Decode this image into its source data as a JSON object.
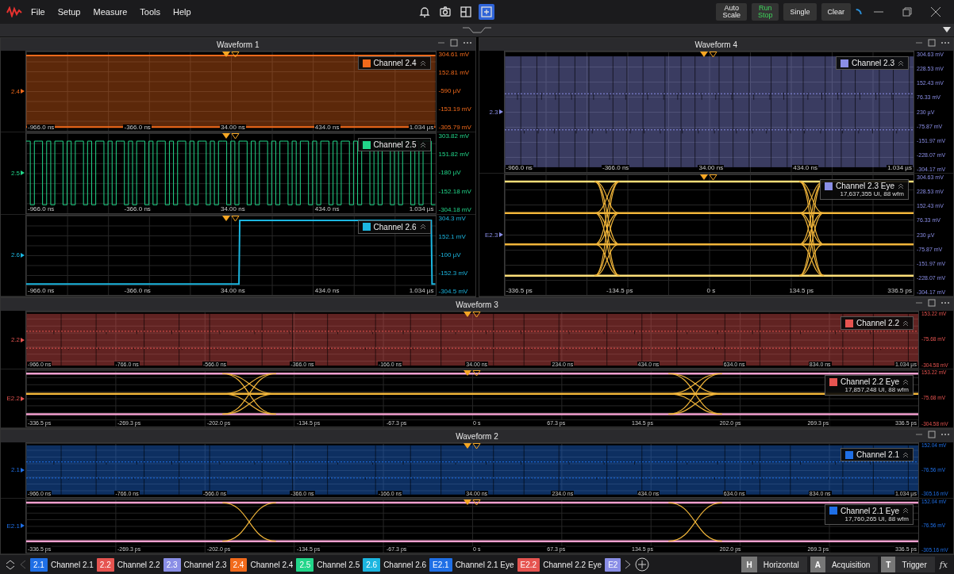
{
  "menubar": {
    "menus": [
      "File",
      "Setup",
      "Measure",
      "Tools",
      "Help"
    ],
    "tools": [
      {
        "kind": "bell",
        "selected": false
      },
      {
        "kind": "camera",
        "selected": false
      },
      {
        "kind": "layout",
        "selected": false
      },
      {
        "kind": "add-pane",
        "selected": true
      }
    ],
    "actions": [
      {
        "lines": [
          "Auto",
          "Scale"
        ],
        "on": false
      },
      {
        "lines": [
          "Run",
          "Stop"
        ],
        "on": true
      },
      {
        "lines": [
          "Single"
        ],
        "on": false
      },
      {
        "lines": [
          "Clear"
        ],
        "on": false
      }
    ]
  },
  "rows": [
    {
      "panels": [
        {
          "title": "Waveform 1",
          "plots": [
            {
              "marker": "2.4",
              "color": "#f26a1b",
              "kind": "band",
              "legend": {
                "name": "Channel 2.4"
              },
              "yticks": [
                "304.61 mV",
                "152.81 mV",
                "-590 µV",
                "-153.19 mV",
                "-305.79 mV"
              ],
              "xticks": [
                "-966.0 ns",
                "-366.0 ns",
                "34.00 ns",
                "434.0 ns",
                "1.034 µs"
              ]
            },
            {
              "marker": "2.5",
              "color": "#22d68a",
              "kind": "digital",
              "legend": {
                "name": "Channel 2.5"
              },
              "yticks": [
                "303.82 mV",
                "151.82 mV",
                "-180 µV",
                "-152.18 mV",
                "-304.18 mV"
              ],
              "xticks": [
                "-966.0 ns",
                "-366.0 ns",
                "34.00 ns",
                "434.0 ns",
                "1.034 µs"
              ]
            },
            {
              "marker": "2.6",
              "color": "#1cb6e0",
              "kind": "step",
              "legend": {
                "name": "Channel 2.6"
              },
              "yticks": [
                "304.3 mV",
                "152.1 mV",
                "-100 µV",
                "-152.3 mV",
                "-304.5 mV"
              ],
              "xticks": [
                "-966.0 ns",
                "-366.0 ns",
                "34.00 ns",
                "434.0 ns",
                "1.034 µs"
              ]
            }
          ]
        },
        {
          "title": "Waveform 4",
          "plots": [
            {
              "marker": "2.3",
              "color": "#8a8ee6",
              "kind": "noise",
              "legend": {
                "name": "Channel 2.3"
              },
              "yticks": [
                "304.63 mV",
                "228.53 mV",
                "152.43 mV",
                "76.33 mV",
                "230 µV",
                "-75.87 mV",
                "-151.97 mV",
                "-228.07 mV",
                "-304.17 mV"
              ],
              "xticks": [
                "-966.0 ns",
                "-366.0 ns",
                "34.00 ns",
                "434.0 ns",
                "1.034 µs"
              ]
            },
            {
              "marker": "E2.3",
              "color": "#8a8ee6",
              "kind": "eye-pam4",
              "legend": {
                "name": "Channel 2.3 Eye",
                "subtitle": "17,637,355 UI, 88 wfm"
              },
              "yticks": [
                "304.63 mV",
                "228.53 mV",
                "152.43 mV",
                "76.33 mV",
                "230 µV",
                "-75.87 mV",
                "-151.97 mV",
                "-228.07 mV",
                "-304.17 mV"
              ],
              "xticks": [
                "-336.5 ps",
                "-134.5 ps",
                "0 s",
                "134.5 ps",
                "336.5 ps"
              ]
            }
          ]
        }
      ]
    },
    {
      "panels": [
        {
          "title": "Waveform 3",
          "plots": [
            {
              "marker": "2.2",
              "color": "#e65450",
              "kind": "noise",
              "legend": {
                "name": "Channel 2.2"
              },
              "yticks": [
                "153.22 mV",
                "-75.68 mV",
                "-304.58 mV"
              ],
              "xticks": [
                "-966.0 ns",
                "-766.0 ns",
                "-566.0 ns",
                "-366.0 ns",
                "-166.0 ns",
                "34.00 ns",
                "234.0 ns",
                "434.0 ns",
                "634.0 ns",
                "834.0 ns",
                "1.034 µs"
              ]
            },
            {
              "marker": "E2.2",
              "color": "#e65450",
              "kind": "eye-pam3",
              "legend": {
                "name": "Channel 2.2 Eye",
                "subtitle": "17,857,248 UI, 88 wfm"
              },
              "yticks": [
                "153.22 mV",
                "-75.68 mV",
                "-304.58 mV"
              ],
              "xticks": [
                "-336.5 ps",
                "-269.3 ps",
                "-202.0 ps",
                "-134.5 ps",
                "-67.3 ps",
                "0 s",
                "67.3 ps",
                "134.5 ps",
                "202.0 ps",
                "269.3 ps",
                "336.5 ps"
              ]
            }
          ]
        }
      ]
    },
    {
      "panels": [
        {
          "title": "Waveform 2",
          "plots": [
            {
              "marker": "2.1",
              "color": "#1f6fe6",
              "kind": "noise",
              "legend": {
                "name": "Channel 2.1"
              },
              "yticks": [
                "152.04 mV",
                "-76.56 mV",
                "-305.16 mV"
              ],
              "xticks": [
                "-966.0 ns",
                "-766.0 ns",
                "-566.0 ns",
                "-366.0 ns",
                "-166.0 ns",
                "34.00 ns",
                "234.0 ns",
                "434.0 ns",
                "634.0 ns",
                "834.0 ns",
                "1.034 µs"
              ]
            },
            {
              "marker": "E2.1",
              "color": "#1f6fe6",
              "kind": "eye-nrz",
              "legend": {
                "name": "Channel 2.1 Eye",
                "subtitle": "17,760,265 UI, 88 wfm"
              },
              "yticks": [
                "152.04 mV",
                "-76.56 mV",
                "-305.16 mV"
              ],
              "xticks": [
                "-336.5 ps",
                "-269.3 ps",
                "-202.0 ps",
                "-134.5 ps",
                "-67.3 ps",
                "0 s",
                "67.3 ps",
                "134.5 ps",
                "202.0 ps",
                "269.3 ps",
                "336.5 ps"
              ]
            }
          ]
        }
      ]
    }
  ],
  "channel_bar": [
    {
      "tag": "2.1",
      "label": "Channel 2.1",
      "color": "#1f6fe6"
    },
    {
      "tag": "2.2",
      "label": "Channel 2.2",
      "color": "#e65450"
    },
    {
      "tag": "2.3",
      "label": "Channel 2.3",
      "color": "#8a8ee6"
    },
    {
      "tag": "2.4",
      "label": "Channel 2.4",
      "color": "#f26a1b"
    },
    {
      "tag": "2.5",
      "label": "Channel 2.5",
      "color": "#22d68a"
    },
    {
      "tag": "2.6",
      "label": "Channel 2.6",
      "color": "#1cb6e0"
    },
    {
      "tag": "E2.1",
      "label": "Channel 2.1 Eye",
      "color": "#1f6fe6"
    },
    {
      "tag": "E2.2",
      "label": "Channel 2.2 Eye",
      "color": "#e65450"
    },
    {
      "tag": "E2",
      "color": "#8a8ee6"
    }
  ],
  "setup_buttons": [
    {
      "key": "H",
      "label": "Horizontal"
    },
    {
      "key": "A",
      "label": "Acquisition"
    },
    {
      "key": "T",
      "label": "Trigger"
    }
  ],
  "math_button": "fx"
}
